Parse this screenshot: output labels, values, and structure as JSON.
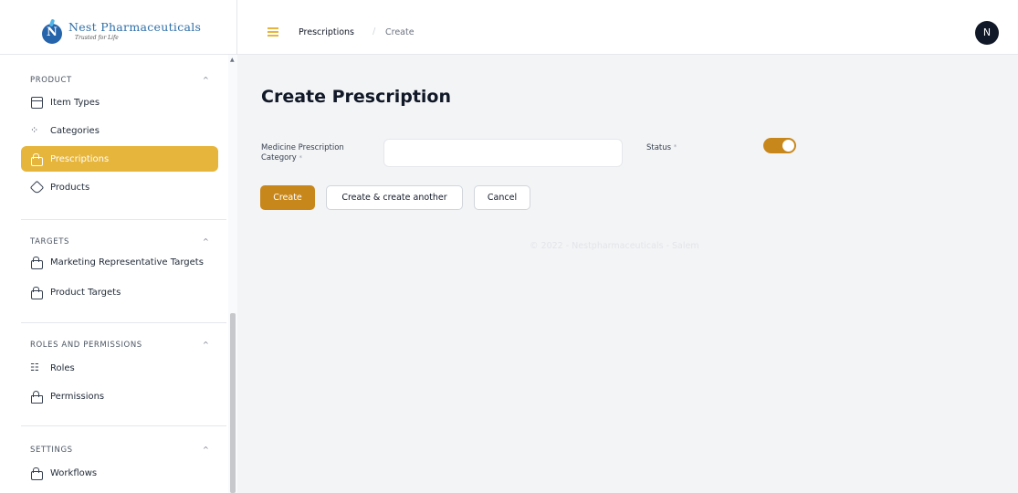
{
  "brand": {
    "logo_letter": "N",
    "name": "Nest Pharmaceuticals",
    "tagline": "Trusted for Life"
  },
  "sidebar": {
    "groups": [
      {
        "title": "PRODUCT",
        "items": [
          {
            "label": "Item Types",
            "icon": "grid-icon",
            "active": false
          },
          {
            "label": "Categories",
            "icon": "dots-icon",
            "active": false
          },
          {
            "label": "Prescriptions",
            "icon": "lock-icon",
            "active": true
          },
          {
            "label": "Products",
            "icon": "tag-icon",
            "active": false
          }
        ]
      },
      {
        "title": "TARGETS",
        "items": [
          {
            "label": "Marketing Representative Targets",
            "icon": "lock-icon",
            "active": false
          },
          {
            "label": "Product Targets",
            "icon": "lock-icon",
            "active": false
          }
        ]
      },
      {
        "title": "ROLES AND PERMISSIONS",
        "items": [
          {
            "label": "Roles",
            "icon": "people-icon",
            "active": false
          },
          {
            "label": "Permissions",
            "icon": "padlock-icon",
            "active": false
          }
        ]
      },
      {
        "title": "SETTINGS",
        "items": [
          {
            "label": "Workflows",
            "icon": "lock-icon",
            "active": false
          }
        ]
      }
    ],
    "chevron": "^"
  },
  "header": {
    "breadcrumb": [
      "Prescriptions",
      "Create"
    ],
    "separator": "/",
    "avatar_initial": "N"
  },
  "main": {
    "title": "Create Prescription",
    "field_label": "Medicine Prescription Category",
    "field_value": "",
    "required_mark": "*",
    "status_label": "Status",
    "status_on": true,
    "buttons": {
      "create": "Create",
      "create_another": "Create & create another",
      "cancel": "Cancel"
    },
    "footer": "© 2022 - Nestpharmaceuticals - Salem"
  },
  "colors": {
    "accent": "#e6b53b",
    "primary_button": "#c8871b",
    "brand_blue": "#2563ab"
  }
}
